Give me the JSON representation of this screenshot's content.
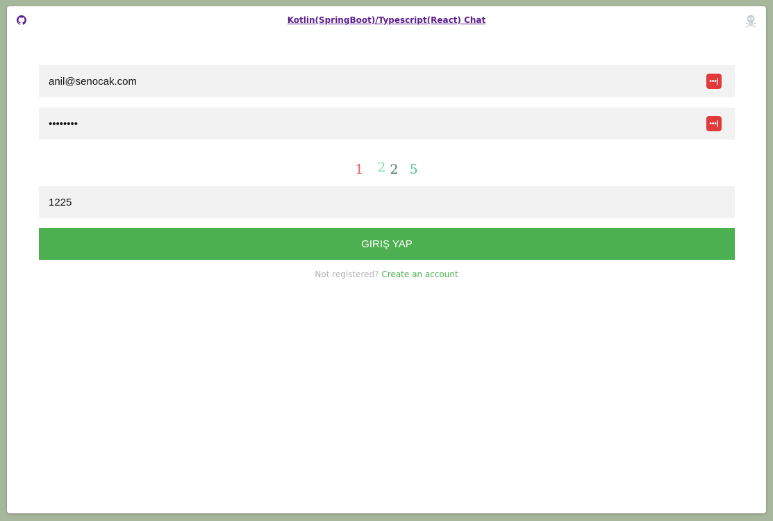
{
  "header": {
    "title": "Kotlin(SpringBoot)/Typescript(React) Chat",
    "github_icon": "github-icon",
    "right_icon": "skull-crossbones-icon"
  },
  "form": {
    "email_value": "anil@senocak.com",
    "password_value": "••••••••",
    "password_manager_icon": "password-manager-icon",
    "captcha": {
      "chars": [
        "1",
        "2",
        "2",
        "5"
      ],
      "colors": [
        "#ef5b5b",
        "#7ee0a0",
        "#3f7a63",
        "#4fc08d"
      ]
    },
    "captcha_answer_value": "1225",
    "submit_label": "GIRIŞ YAP"
  },
  "footer": {
    "prompt": "Not registered?",
    "link_label": "Create an account"
  },
  "colors": {
    "accent": "#4caf50",
    "title": "#5a1e8c",
    "field_bg": "#f2f2f2",
    "page_bg": "#a7b79b"
  }
}
